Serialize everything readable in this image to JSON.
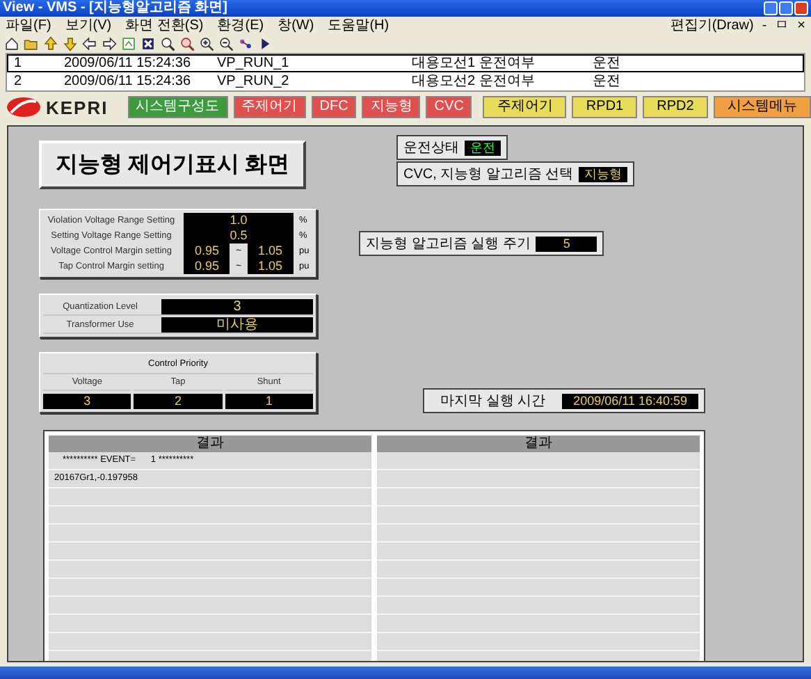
{
  "window": {
    "title": "View - VMS - [지능형알고리즘 화면]"
  },
  "menu": {
    "items": [
      "파일(F)",
      "보기(V)",
      "화면 전환(S)",
      "환경(E)",
      "창(W)",
      "도움말(H)"
    ],
    "right_label": "편집기(Draw)",
    "controls": [
      "-",
      "ㅁ",
      "×"
    ]
  },
  "event_list": {
    "rows": [
      {
        "no": "1",
        "time": "2009/06/11 15:24:36",
        "tag": "VP_RUN_1",
        "description": "대용모선1 운전여부",
        "value": "운전",
        "selected": true
      },
      {
        "no": "2",
        "time": "2009/06/11 15:24:36",
        "tag": "VP_RUN_2",
        "description": "대용모선2 운전여부",
        "value": "운전",
        "selected": false
      }
    ]
  },
  "nav": {
    "logo": "KEPRI",
    "left_buttons": [
      {
        "label": "시스템구성도",
        "color": "#3f9a3f"
      },
      {
        "label": "주제어기",
        "color": "#e05050"
      },
      {
        "label": "DFC",
        "color": "#e05050"
      },
      {
        "label": "지능형",
        "color": "#e05050"
      },
      {
        "label": "CVC",
        "color": "#e05050"
      }
    ],
    "right_buttons": [
      {
        "label": "주제어기",
        "color": "#e6dc5a"
      },
      {
        "label": "RPD1",
        "color": "#e6dc5a"
      },
      {
        "label": "RPD2",
        "color": "#e6dc5a"
      },
      {
        "label": "시스템메뉴",
        "color": "#f0a040"
      }
    ]
  },
  "screen_title": "지능형 제어기표시 화면",
  "run_state": {
    "label": "운전상태",
    "value": "운전"
  },
  "algorithm_select": {
    "label": "CVC, 지능형 알고리즘 선택",
    "value": "지능형"
  },
  "settings": [
    {
      "label": "Violation Voltage Range Setting",
      "values": [
        "1.0"
      ],
      "unit": "%"
    },
    {
      "label": "Setting Voltage Range Setting",
      "values": [
        "0.5"
      ],
      "unit": "%"
    },
    {
      "label": "Voltage Control Margin setting",
      "values": [
        "0.95",
        "1.05"
      ],
      "separator": "~",
      "unit": "pu"
    },
    {
      "label": "Tap Control Margin setting",
      "values": [
        "0.95",
        "1.05"
      ],
      "separator": "~",
      "unit": "pu"
    }
  ],
  "run_period": {
    "label": "지능형 알고리즘 실행 주기",
    "value": "5"
  },
  "quantization": [
    {
      "label": "Quantization Level",
      "value": "3"
    },
    {
      "label": "Transformer Use",
      "value": "미사용"
    }
  ],
  "control_priority": {
    "title": "Control Priority",
    "columns": [
      {
        "label": "Voltage",
        "value": "3"
      },
      {
        "label": "Tap",
        "value": "2"
      },
      {
        "label": "Shunt",
        "value": "1"
      }
    ]
  },
  "last_run": {
    "label": "마지막 실행 시간",
    "value": "2009/06/11 16:40:59"
  },
  "results": [
    {
      "title": "결과",
      "rows": [
        "********** EVENT=      1 **********",
        "20167Gr1,-0.197958"
      ]
    },
    {
      "title": "결과"
    }
  ]
}
